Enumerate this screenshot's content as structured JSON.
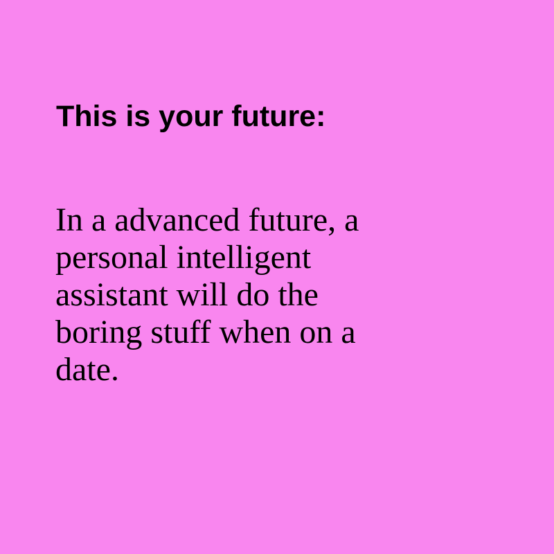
{
  "colors": {
    "background": "#f986ef",
    "text": "#000000"
  },
  "heading": "This is your future:",
  "body_lines": [
    "In a advanced future, a",
    "personal intelligent",
    "assistant will do the",
    "boring stuff when on a",
    "date."
  ]
}
